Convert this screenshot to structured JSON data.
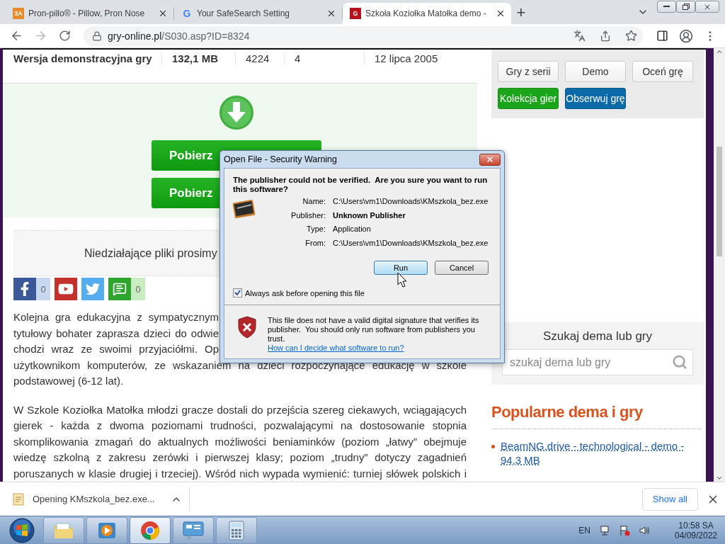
{
  "browser": {
    "tabs": [
      {
        "title": "Pron-pillo® - Pillow, Pron Nose",
        "favicon": "3A",
        "kind": "box",
        "selected": false
      },
      {
        "title": "Your SafeSearch Setting",
        "favicon": "G",
        "kind": "google",
        "selected": false
      },
      {
        "title": "Szkoła Koziołka Matołka demo -",
        "favicon": "G",
        "kind": "box",
        "selected": true
      }
    ],
    "new_tab": "+",
    "url_host": "gry-online.pl",
    "url_path": "/S030.asp?ID=8324"
  },
  "page": {
    "file_row": [
      "Wersja demonstracyjna gry",
      "132,1 MB",
      "4224",
      "4",
      "12 lipca 2005"
    ],
    "download_buttons": [
      "Pobierz",
      "Pobierz"
    ],
    "notice": "Niedziałające pliki prosimy",
    "social": [
      {
        "kind": "facebook",
        "count": "0"
      },
      {
        "kind": "youtube"
      },
      {
        "kind": "twitter"
      },
      {
        "kind": "comments",
        "count": "0"
      }
    ],
    "description": {
      "cut_lines": [
        "Kolejna gra edukacyjna z sympatycznym",
        "tytułowy bohater zaprasza dzieci do odwie",
        "chodzi wraz ze swoimi przyjaciółmi. Op"
      ],
      "lines": [
        "użytkownikom komputerów, ze wskazaniem na dzieci rozpoczynające edukację w szkole",
        "podstawowej (6-12 lat)."
      ]
    },
    "paragraph": [
      "W Szkole Koziołka Matołka młodzi gracze dostali do przejścia szereg ciekawych, wciągających",
      "gierek - każda z dwoma poziomami trudności, pozwalającymi na dostosowanie stopnia",
      "skomplikowania zmagań do aktualnych możliwości beniaminków (poziom „łatwy” obejmuje",
      "wiedzę szkolną z zakresu zerówki i pierwszej klasy; poziom „trudny” dotyczy zagadnień",
      "poruszanych w klasie drugiej i trzeciej). Wśród nich wypada wymienić: turniej słówek polskich i"
    ]
  },
  "sidebar": {
    "buttons": [
      {
        "label": "Gry z serii",
        "kind": "plain"
      },
      {
        "label": "Demo",
        "kind": "plain"
      },
      {
        "label": "Oceń grę",
        "kind": "plain"
      },
      {
        "label": "Kolekcja gier",
        "kind": "green"
      },
      {
        "label": "Obserwuj grę",
        "kind": "blue"
      }
    ],
    "search": {
      "title": "Szukaj dema lub gry",
      "placeholder": "szukaj dema lub gry"
    },
    "popular": {
      "title": "Popularne dema i gry",
      "items": [
        "BeamNG.drive - technological - demo - 94,3 MB"
      ]
    }
  },
  "dialog": {
    "title": "Open File - Security Warning",
    "heading": "The publisher could not be verified.  Are you sure you want to run this software?",
    "fields": [
      {
        "label": "Name:",
        "value": "C:\\Users\\vm1\\Downloads\\KMszkola_bez.exe",
        "emphasis": false
      },
      {
        "label": "Publisher:",
        "value": "Unknown Publisher",
        "emphasis": true
      },
      {
        "label": "Type:",
        "value": "Application",
        "emphasis": false
      },
      {
        "label": "From:",
        "value": "C:\\Users\\vm1\\Downloads\\KMszkola_bez.exe",
        "emphasis": false
      }
    ],
    "buttons": [
      {
        "label": "Run",
        "focused": true
      },
      {
        "label": "Cancel",
        "focused": false
      }
    ],
    "checkbox": {
      "label": "Always ask before opening this file",
      "checked": true
    },
    "warning": "This file does not have a valid digital signature that verifies its publisher.  You should only run software from publishers you trust.",
    "help_link": "How can I decide what software to run?"
  },
  "downloads": {
    "file": "Opening KMszkola_bez.exe...",
    "show_all": "Show all"
  },
  "taskbar": {
    "apps": [
      {
        "kind": "explorer",
        "active": false
      },
      {
        "kind": "media",
        "active": false
      },
      {
        "kind": "chrome",
        "active": true
      },
      {
        "kind": "control",
        "active": false
      },
      {
        "kind": "calculator",
        "active": false
      }
    ],
    "language": "EN",
    "time": "10:58 SA",
    "date": "04/09/2022"
  }
}
